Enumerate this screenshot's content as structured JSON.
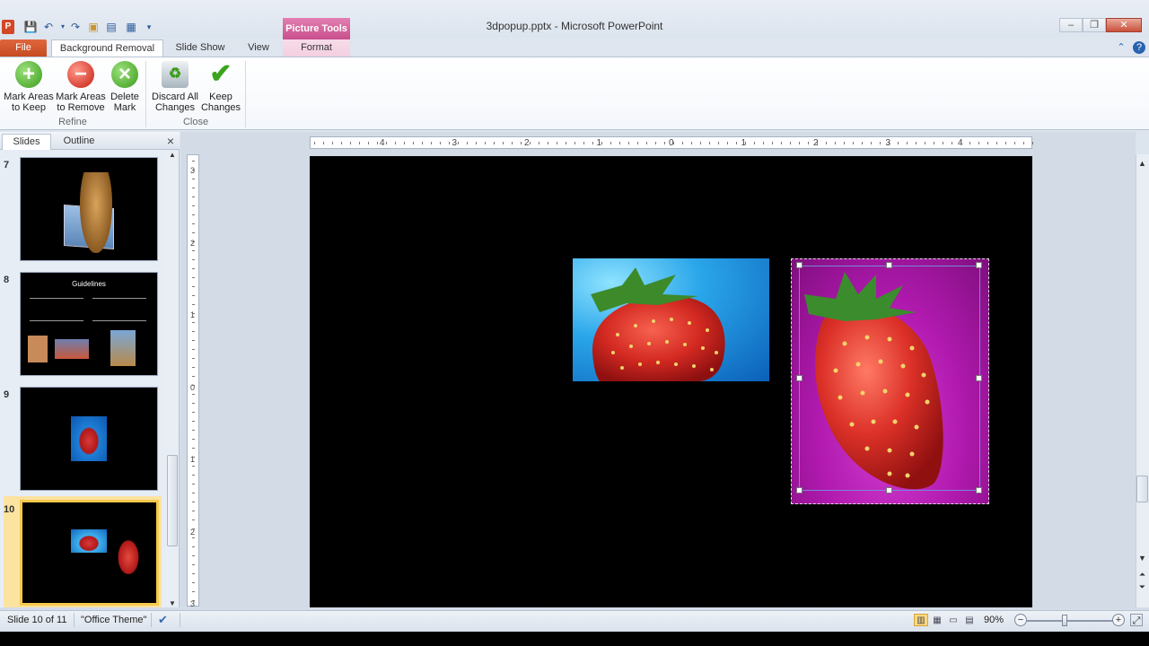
{
  "window": {
    "title": "3dpopup.pptx - Microsoft PowerPoint",
    "context_tab_group": "Picture Tools",
    "minimize": "–",
    "restore": "❐",
    "close": "✕"
  },
  "tabs": {
    "file": "File",
    "background_removal": "Background Removal",
    "slide_show": "Slide Show",
    "view": "View",
    "format": "Format"
  },
  "ribbon": {
    "mark_keep": "Mark Areas to Keep",
    "mark_keep_l1": "Mark Areas",
    "mark_keep_l2": "to Keep",
    "mark_remove_l1": "Mark Areas",
    "mark_remove_l2": "to Remove",
    "delete_mark_l1": "Delete",
    "delete_mark_l2": "Mark",
    "discard_l1": "Discard All",
    "discard_l2": "Changes",
    "keep_l1": "Keep",
    "keep_l2": "Changes",
    "group_refine": "Refine",
    "group_close": "Close"
  },
  "left_pane": {
    "tab_slides": "Slides",
    "tab_outline": "Outline",
    "close": "×",
    "slides": [
      {
        "number": "7"
      },
      {
        "number": "8",
        "title": "Guidelines"
      },
      {
        "number": "9"
      },
      {
        "number": "10"
      }
    ]
  },
  "rulers": {
    "h_labels": [
      "4",
      "3",
      "2",
      "1",
      "0",
      "1",
      "2",
      "3",
      "4"
    ],
    "v_labels": [
      "3",
      "2",
      "1",
      "0",
      "1",
      "2",
      "3"
    ]
  },
  "status": {
    "slide_info": "Slide 10 of 11",
    "theme": "\"Office Theme\"",
    "zoom": "90%",
    "zoom_minus": "−",
    "zoom_plus": "+"
  },
  "colors": {
    "file_tab": "#d24726",
    "picture_tools": "#c94f8e",
    "selection_highlight": "#f7c94d"
  }
}
